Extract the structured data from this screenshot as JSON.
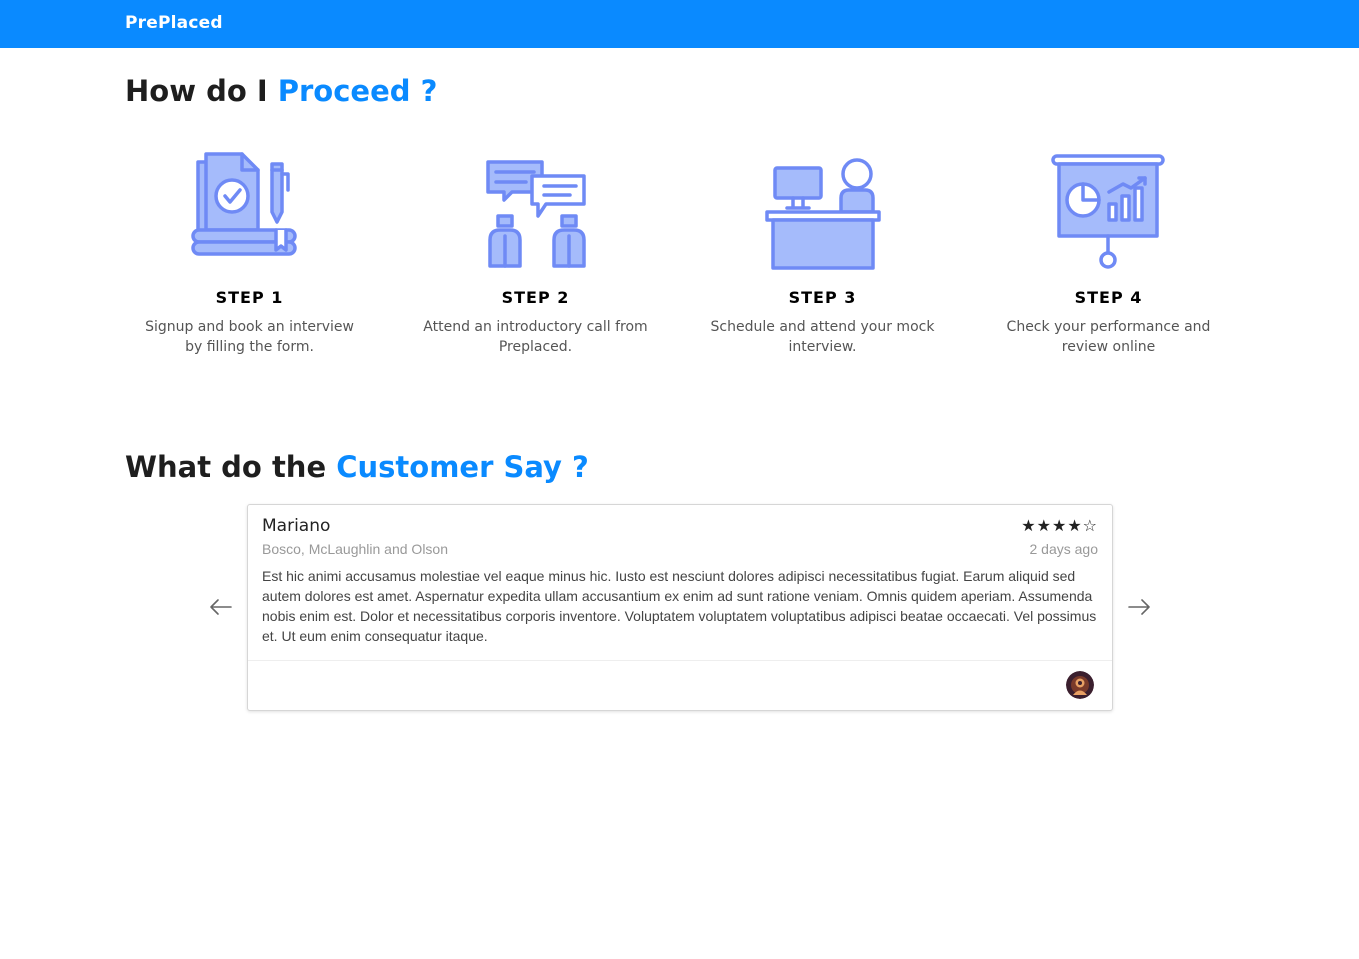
{
  "navbar": {
    "brand": "PrePlaced",
    "color": "#0a8aff"
  },
  "process": {
    "heading_plain": "How do I ",
    "heading_accent": "Proceed ?",
    "steps": [
      {
        "title": "STEP 1",
        "description": "Signup and book an interview by filling the form.",
        "icon": "signup-form-icon"
      },
      {
        "title": "STEP 2",
        "description": "Attend an introductory call from Preplaced.",
        "icon": "conversation-icon"
      },
      {
        "title": "STEP 3",
        "description": "Schedule and attend your mock interview.",
        "icon": "interview-desk-icon"
      },
      {
        "title": "STEP 4",
        "description": "Check your performance and review online",
        "icon": "presentation-chart-icon"
      }
    ]
  },
  "testimonials": {
    "heading_plain": "What do the ",
    "heading_accent": "Customer Say ?",
    "prev_icon": "arrow-left-icon",
    "next_icon": "arrow-right-icon",
    "review": {
      "name": "Mariano",
      "company": "Bosco, McLaughlin and Olson",
      "stars": "★★★★☆",
      "rating": 4,
      "rating_max": 5,
      "time": "2 days ago",
      "body": "Est hic animi accusamus molestiae vel eaque minus hic. Iusto est nesciunt dolores adipisci necessitatibus fugiat. Earum aliquid sed autem dolores est amet. Aspernatur expedita ullam accusantium ex enim ad sunt ratione veniam. Omnis quidem aperiam. Assumenda nobis enim est. Dolor et necessitatibus corporis inventore. Voluptatem voluptatem voluptatibus adipisci beatae occaecati. Vel possimus et. Ut eum enim consequatur itaque."
    }
  },
  "colors": {
    "accent": "#0a8aff",
    "icon_fill": "#a5bbfb",
    "icon_stroke": "#6f8af5"
  }
}
